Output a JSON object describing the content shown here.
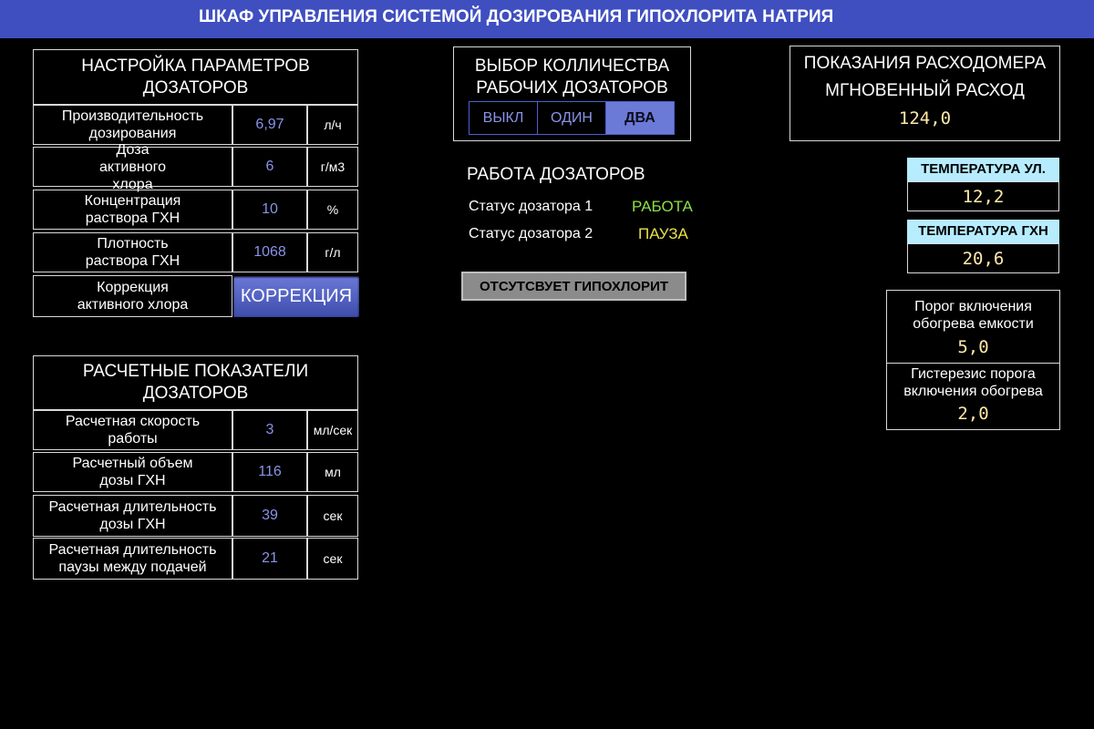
{
  "title": "ШКАФ УПРАВЛЕНИЯ СИСТЕМОЙ ДОЗИРОВАНИЯ ГИПОХЛОРИТА НАТРИЯ",
  "settings": {
    "header": "НАСТРОЙКА ПАРАМЕТРОВ ДОЗАТОРОВ",
    "rows": [
      {
        "label": "Производительность дозирования",
        "value": "6,97",
        "unit": "л/ч"
      },
      {
        "label": "Доза активного хлора",
        "value": "6",
        "unit": "г/м3"
      },
      {
        "label": "Концентрация раствора ГХН",
        "value": "10",
        "unit": "%"
      },
      {
        "label": "Плотность раствора ГХН",
        "value": "1068",
        "unit": "г/л"
      }
    ],
    "correction_label": "Коррекция активного хлора",
    "correction_button": "КОРРЕКЦИЯ"
  },
  "calc": {
    "header": "РАСЧЕТНЫЕ ПОКАЗАТЕЛИ ДОЗАТОРОВ",
    "rows": [
      {
        "label": "Расчетная скорость работы",
        "value": "3",
        "unit": "мл/сек"
      },
      {
        "label": "Расчетный объем дозы ГХН",
        "value": "116",
        "unit": "мл"
      },
      {
        "label": "Расчетная длительность дозы ГХН",
        "value": "39",
        "unit": "сек"
      },
      {
        "label": "Расчетная длительность паузы между подачей",
        "value": "21",
        "unit": "сек"
      }
    ]
  },
  "selector": {
    "header": "ВЫБОР КОЛЛИЧЕСТВА РАБОЧИХ ДОЗАТОРОВ",
    "options": [
      "ВЫКЛ",
      "ОДИН",
      "ДВА"
    ],
    "selected": "ДВА"
  },
  "work": {
    "header": "РАБОТА ДОЗАТОРОВ",
    "status1_label": "Статус дозатора 1",
    "status1_value": "РАБОТА",
    "status2_label": "Статус дозатора 2",
    "status2_value": "ПАУЗА",
    "alarm": "ОТСУТСВУЕТ ГИПОХЛОРИТ"
  },
  "flowmeter": {
    "line1": "ПОКАЗАНИЯ РАСХОДОМЕРА",
    "line2": "МГНОВЕННЫЙ РАСХОД",
    "value": "124,0"
  },
  "temp_street": {
    "label": "ТЕМПЕРАТУРА УЛ.",
    "value": "12,2"
  },
  "temp_gxn": {
    "label": "ТЕМПЕРАТУРА ГХН",
    "value": "20,6"
  },
  "heating": {
    "threshold_label": "Порог включения обогрева емкости",
    "threshold_value": "5,0",
    "hysteresis_label": "Гистерезис порога включения обогрева",
    "hysteresis_value": "2,0"
  },
  "colors": {
    "titlebar": "#3f4fbf",
    "value_text": "#8a93e8",
    "status_work": "#8be04a",
    "status_pause": "#e8e04a",
    "temp_label_bg": "#b7ecff",
    "lcd_text": "#ffe9a8"
  }
}
